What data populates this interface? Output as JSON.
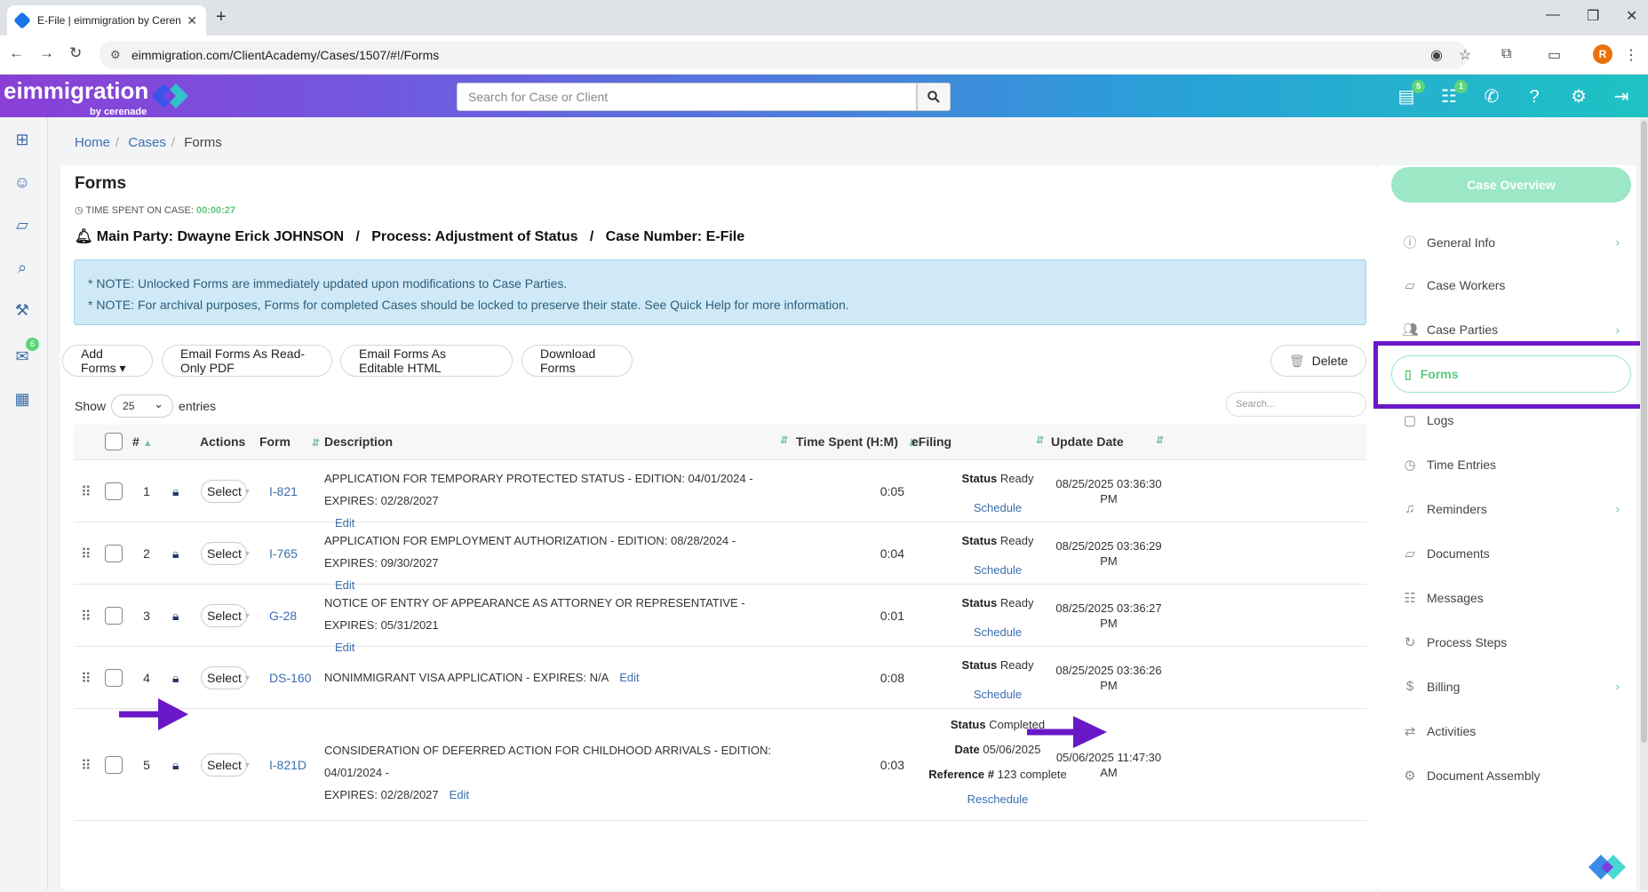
{
  "browser": {
    "tab_title": "E-File | eimmigration by Cerenade",
    "url": "eimmigration.com/ClientAcademy/Cases/1507/#!/Forms",
    "profile_initial": "R"
  },
  "header": {
    "logo": "eimmigration",
    "logo_sub": "by cerenade",
    "search_placeholder": "Search for Case or Client",
    "badges": {
      "cases": "5",
      "chat": "1"
    }
  },
  "leftrail": {
    "mail_badge": "6"
  },
  "breadcrumb": {
    "home": "Home",
    "cases": "Cases",
    "current": "Forms"
  },
  "page": {
    "title": "Forms",
    "time_label": "TIME SPENT ON CASE:",
    "time_value": "00:00:27",
    "party_line": "Main Party: Dwayne Erick JOHNSON   /   Process: Adjustment of Status   /   Case Number: E-File",
    "note1": "* NOTE: Unlocked Forms are immediately updated upon modifications to Case Parties.",
    "note2": "* NOTE: For archival purposes, Forms for completed Cases should be locked to preserve their state. See Quick Help for more information."
  },
  "toolbar": {
    "add_forms": "Add Forms ▾",
    "email_pdf": "Email Forms As Read-Only PDF",
    "email_html": "Email Forms As Editable HTML",
    "download": "Download Forms",
    "delete": "Delete"
  },
  "table": {
    "show_label": "Show",
    "entries_label": "entries",
    "page_size": "25",
    "search_placeholder": "Search...",
    "headers": {
      "num": "#",
      "actions": "Actions",
      "form": "Form",
      "description": "Description",
      "time": "Time Spent (H:M)",
      "efiling": "eFiling",
      "update": "Update Date"
    },
    "select_label": "Select",
    "edit_label": "Edit",
    "status_label": "Status",
    "rows": [
      {
        "num": "1",
        "form": "I-821",
        "desc": "APPLICATION FOR TEMPORARY PROTECTED STATUS - EDITION: 04/01/2024 - EXPIRES: 02/28/2027",
        "time": "0:05",
        "status": "Ready",
        "action": "Schedule",
        "date1": "08/25/2025 03:36:30",
        "date2": "PM"
      },
      {
        "num": "2",
        "form": "I-765",
        "desc": "APPLICATION FOR EMPLOYMENT AUTHORIZATION - EDITION: 08/28/2024 - EXPIRES: 09/30/2027",
        "time": "0:04",
        "status": "Ready",
        "action": "Schedule",
        "date1": "08/25/2025 03:36:29",
        "date2": "PM"
      },
      {
        "num": "3",
        "form": "G-28",
        "desc": "NOTICE OF ENTRY OF APPEARANCE AS ATTORNEY OR REPRESENTATIVE - EXPIRES: 05/31/2021",
        "time": "0:01",
        "status": "Ready",
        "action": "Schedule",
        "date1": "08/25/2025 03:36:27",
        "date2": "PM"
      },
      {
        "num": "4",
        "form": "DS-160",
        "desc": "NONIMMIGRANT VISA APPLICATION - EXPIRES: N/A",
        "time": "0:08",
        "status": "Ready",
        "action": "Schedule",
        "date1": "08/25/2025 03:36:26",
        "date2": "PM"
      },
      {
        "num": "5",
        "form": "I-821D",
        "desc1": "CONSIDERATION OF DEFERRED ACTION FOR CHILDHOOD ARRIVALS - EDITION: 04/01/2024 -",
        "desc2": "EXPIRES: 02/28/2027",
        "time": "0:03",
        "status": "Completed",
        "date_label": "Date",
        "date_value": "05/06/2025",
        "ref_label": "Reference #",
        "ref_value": "123 complete",
        "action": "Reschedule",
        "date1": "05/06/2025 11:47:30",
        "date2": "AM"
      }
    ]
  },
  "sidebar": {
    "overview": "Case Overview",
    "items": [
      "General Info",
      "Case Workers",
      "Case Parties",
      "Forms",
      "Logs",
      "Time Entries",
      "Reminders",
      "Documents",
      "Messages",
      "Process Steps",
      "Billing",
      "Activities",
      "Document Assembly"
    ]
  },
  "colors": {
    "accent_green": "#5cc97a",
    "highlight_purple": "#6a17c8",
    "link_blue": "#3a6fb0"
  }
}
